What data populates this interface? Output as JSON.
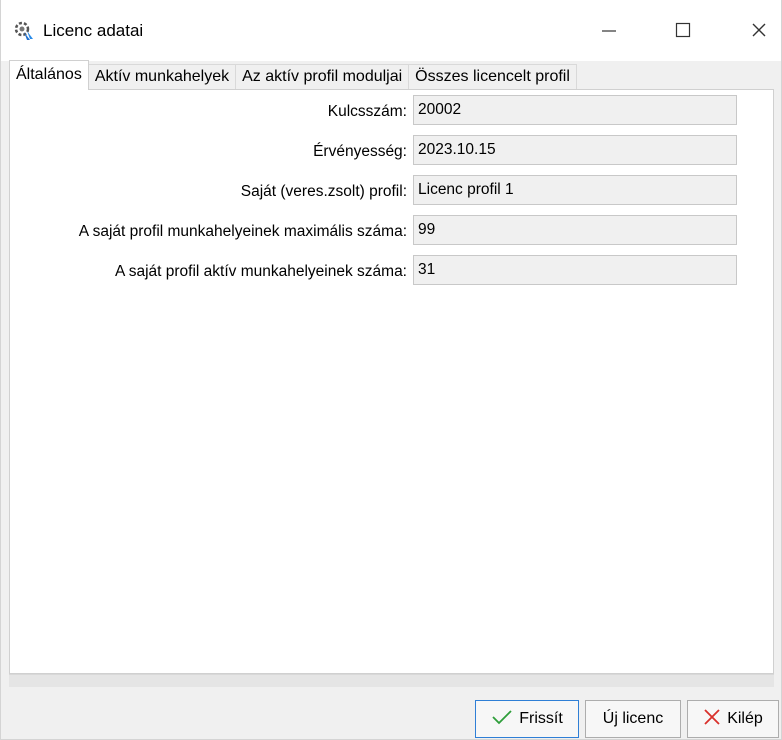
{
  "window": {
    "title": "Licenc adatai",
    "icon": "license-gear-icon",
    "controls": [
      "minimize-icon",
      "maximize-icon",
      "close-icon"
    ]
  },
  "tabs": [
    {
      "label": "Általános",
      "active": true
    },
    {
      "label": "Aktív munkahelyek",
      "active": false
    },
    {
      "label": "Az aktív profil moduljai",
      "active": false
    },
    {
      "label": "Összes licencelt profil",
      "active": false
    }
  ],
  "fields": [
    {
      "label": "Kulcsszám:",
      "value": "20002"
    },
    {
      "label": "Érvényesség:",
      "value": "2023.10.15"
    },
    {
      "label": "Saját (veres.zsolt) profil:",
      "value": "Licenc profil 1"
    },
    {
      "label": "A saját profil munkahelyeinek maximális száma:",
      "value": "99"
    },
    {
      "label": "A saját profil aktív munkahelyeinek száma:",
      "value": "31"
    }
  ],
  "buttons": {
    "refresh": {
      "label": "Frissít",
      "icon": "checkmark-icon",
      "icon_color": "#2e9e3a"
    },
    "new_license": {
      "label": "Új licenc"
    },
    "exit": {
      "label": "Kilép",
      "icon": "x-icon",
      "icon_color": "#d9302b"
    }
  }
}
